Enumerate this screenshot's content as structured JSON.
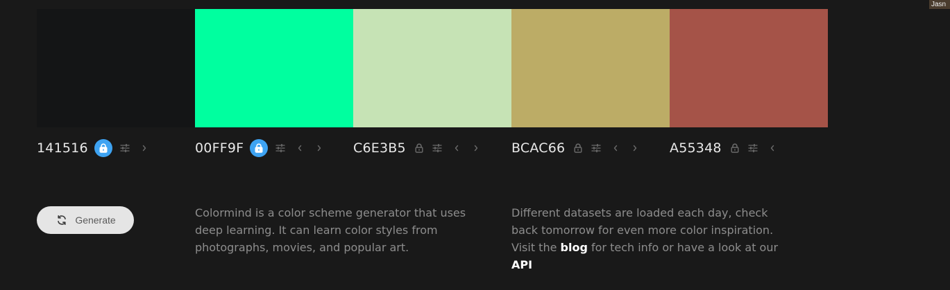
{
  "palette": [
    {
      "hex": "141516",
      "color": "#141516",
      "locked": true,
      "has_left_arrow": false,
      "has_right_arrow": true
    },
    {
      "hex": "00FF9F",
      "color": "#00FF9F",
      "locked": true,
      "has_left_arrow": true,
      "has_right_arrow": true
    },
    {
      "hex": "C6E3B5",
      "color": "#C6E3B5",
      "locked": false,
      "has_left_arrow": true,
      "has_right_arrow": true
    },
    {
      "hex": "BCAC66",
      "color": "#BCAC66",
      "locked": false,
      "has_left_arrow": true,
      "has_right_arrow": true
    },
    {
      "hex": "A55348",
      "color": "#A55348",
      "locked": false,
      "has_left_arrow": true,
      "has_right_arrow": false
    }
  ],
  "icons": {
    "lock": "lock-icon",
    "adjust": "sliders-icon",
    "left": "chevron-left-icon",
    "right": "chevron-right-icon",
    "generate": "refresh-icon"
  },
  "generate": {
    "label": "Generate"
  },
  "about": {
    "text": "Colormind is a color scheme generator that uses deep learning. It can learn color styles from photographs, movies, and popular art."
  },
  "datasets": {
    "text_before": "Different datasets are loaded each day, check back tomorrow for even more color inspiration. Visit the ",
    "blog_link": "blog",
    "text_middle": " for tech info or have a look at our ",
    "api_link": "API"
  },
  "user_tag": {
    "label": "Jasn"
  },
  "colors": {
    "background": "#191919",
    "lock_active": "#3ea3f2",
    "hex_text": "#e8e8e8",
    "body_text": "#8d8d8d",
    "icon_muted": "#6a6a6a"
  }
}
